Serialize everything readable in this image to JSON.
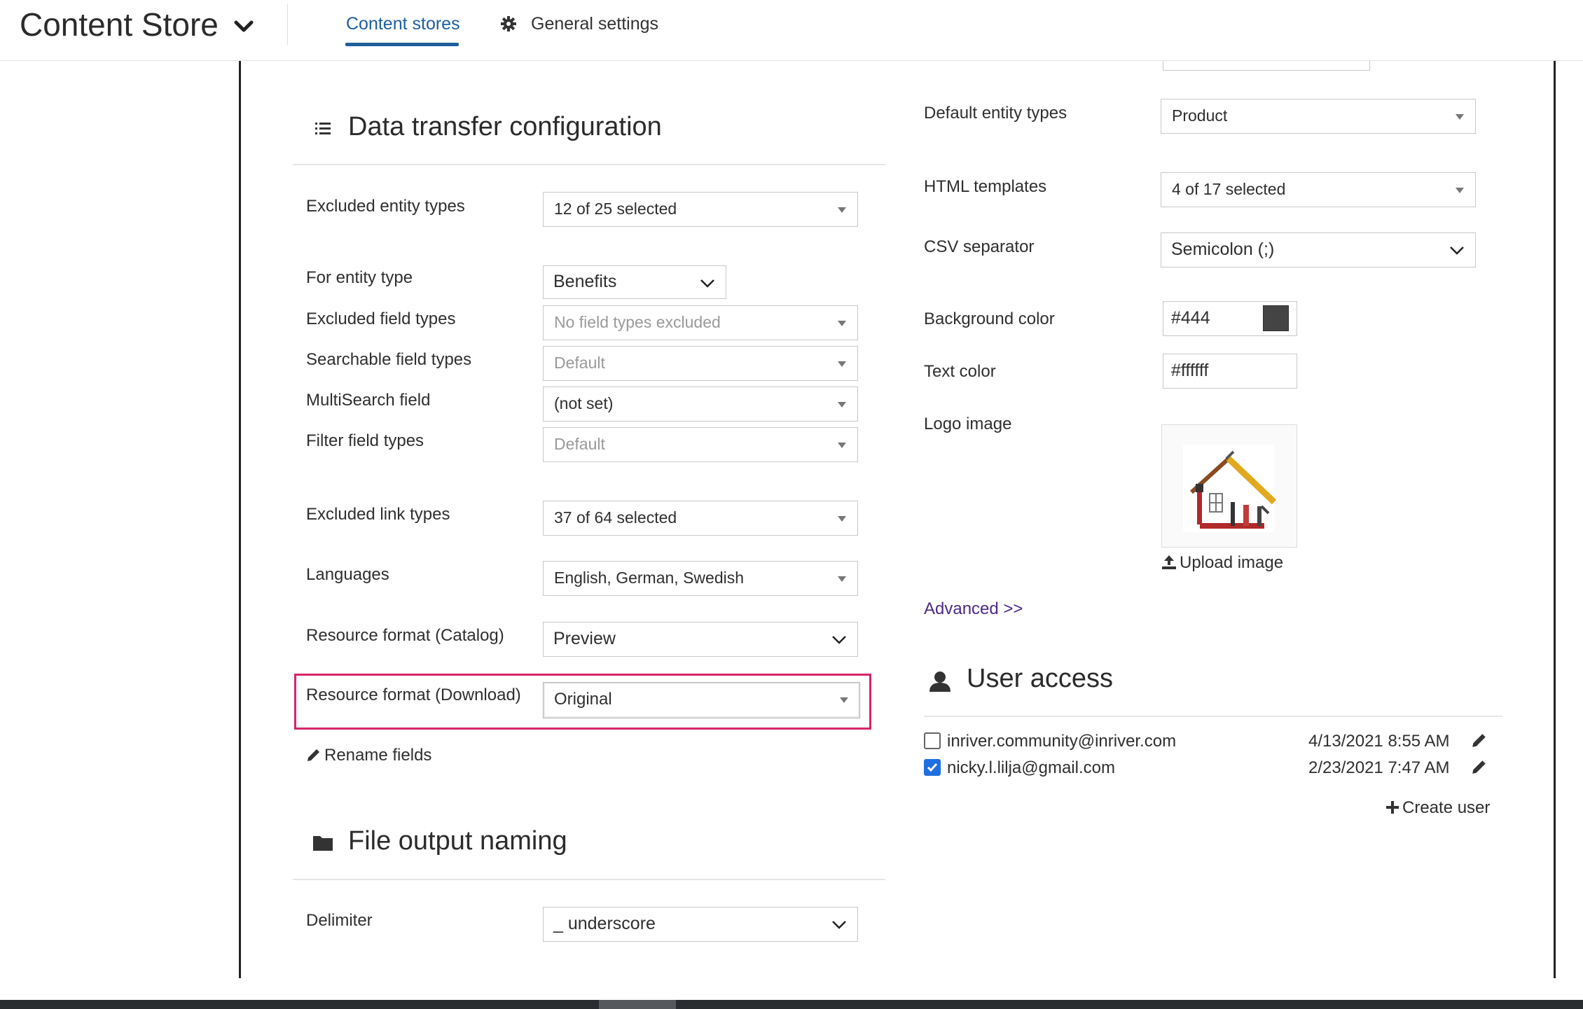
{
  "header": {
    "app_title": "Content Store",
    "tabs": [
      {
        "label": "Content stores",
        "active": true
      },
      {
        "label": "General settings",
        "active": false
      }
    ]
  },
  "data_transfer": {
    "title": "Data transfer configuration",
    "fields": {
      "excluded_entity_types": {
        "label": "Excluded entity types",
        "value": "12 of 25 selected"
      },
      "for_entity_type": {
        "label": "For entity type",
        "value": "Benefits"
      },
      "excluded_field_types": {
        "label": "Excluded field types",
        "value": "No field types excluded"
      },
      "searchable_field_types": {
        "label": "Searchable field types",
        "value": "Default"
      },
      "multisearch_field": {
        "label": "MultiSearch field",
        "value": "(not set)"
      },
      "filter_field_types": {
        "label": "Filter field types",
        "value": "Default"
      },
      "excluded_link_types": {
        "label": "Excluded link types",
        "value": "37 of 64 selected"
      },
      "languages": {
        "label": "Languages",
        "value": "English, German, Swedish"
      },
      "resource_format_catalog": {
        "label": "Resource format (Catalog)",
        "value": "Preview"
      },
      "resource_format_download": {
        "label": "Resource format (Download)",
        "value": "Original"
      }
    },
    "rename_fields": "Rename fields"
  },
  "file_output": {
    "title": "File output naming",
    "delimiter": {
      "label": "Delimiter",
      "value": "_ underscore"
    }
  },
  "right_panel": {
    "default_entity_types": {
      "label": "Default entity types",
      "value": "Product"
    },
    "html_templates": {
      "label": "HTML templates",
      "value": "4 of 17 selected"
    },
    "csv_separator": {
      "label": "CSV separator",
      "value": "Semicolon (;)"
    },
    "background_color": {
      "label": "Background color",
      "value": "#444",
      "swatch": "#444444"
    },
    "text_color": {
      "label": "Text color",
      "value": "#ffffff"
    },
    "logo_image": {
      "label": "Logo image",
      "upload": "Upload image"
    },
    "advanced": "Advanced >>"
  },
  "user_access": {
    "title": "User access",
    "users": [
      {
        "email": "inriver.community@inriver.com",
        "date": "4/13/2021 8:55 AM",
        "checked": false
      },
      {
        "email": "nicky.l.lilja@gmail.com",
        "date": "2/23/2021 7:47 AM",
        "checked": true
      }
    ],
    "create_user": "Create user"
  },
  "colors": {
    "accent": "#1f5f9c",
    "highlight": "#d6256a",
    "link": "#4e2a84",
    "checkbox": "#1f6fe0"
  }
}
